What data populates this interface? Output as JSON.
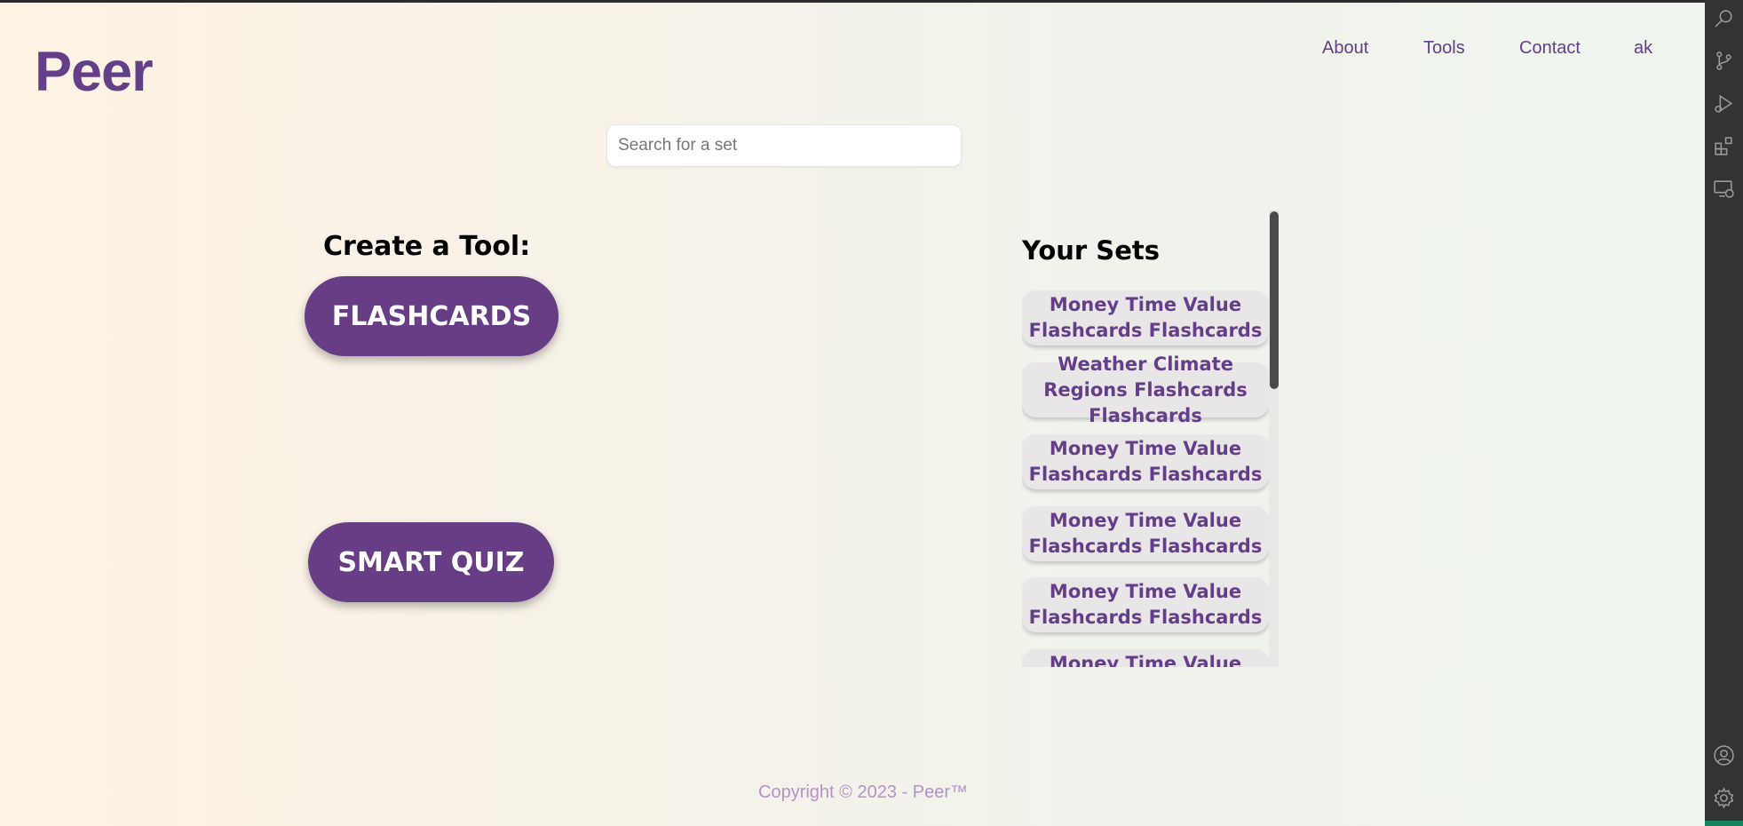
{
  "app": {
    "logo": "Peer"
  },
  "nav": {
    "about": "About",
    "tools": "Tools",
    "contact": "Contact",
    "user": "ak"
  },
  "search": {
    "placeholder": "Search for a set",
    "value": ""
  },
  "create": {
    "title": "Create a Tool:",
    "flashcards_label": "FLASHCARDS",
    "smart_quiz_label": "SMART QUIZ"
  },
  "sets": {
    "title": "Your Sets",
    "items": [
      {
        "label": "Money Time Value Flashcards Flashcards"
      },
      {
        "label": "Weather Climate Regions Flashcards Flashcards"
      },
      {
        "label": "Money Time Value Flashcards Flashcards"
      },
      {
        "label": "Money Time Value Flashcards Flashcards"
      },
      {
        "label": "Money Time Value Flashcards Flashcards"
      },
      {
        "label": "Money Time Value Flashcards Flashcards"
      }
    ]
  },
  "footer": {
    "text": "Copyright © 2023 - Peer™"
  },
  "activity_bar": {
    "icons": [
      "search-icon",
      "source-control-icon",
      "run-debug-icon",
      "extensions-icon",
      "remote-explorer-icon",
      "account-icon",
      "settings-gear-icon"
    ]
  },
  "colors": {
    "brand": "#643e88",
    "button": "#673e86",
    "set_item_bg": "#e8e6e6",
    "footer": "#b391c9"
  }
}
